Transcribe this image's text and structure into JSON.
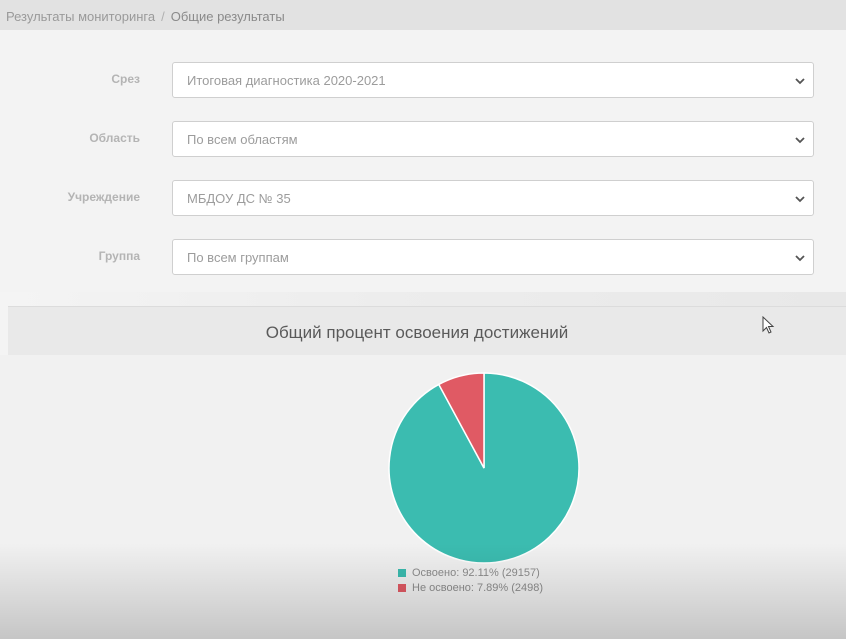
{
  "breadcrumb": {
    "parent": "Результаты мониторинга",
    "separator": "/",
    "current": "Общие результаты"
  },
  "filters": [
    {
      "label": "Срез",
      "value": "Итоговая диагностика 2020-2021"
    },
    {
      "label": "Область",
      "value": "По всем областям"
    },
    {
      "label": "Учреждение",
      "value": "МБДОУ ДС № 35"
    },
    {
      "label": "Группа",
      "value": "По всем группам"
    }
  ],
  "icons": {
    "dropdown": "chevron-down-icon",
    "cursor": "mouse-pointer-icon"
  },
  "chart_data": {
    "type": "pie",
    "title": "Общий процент освоения достижений",
    "slices": [
      {
        "name": "Освоено",
        "percent": 92.11,
        "count": 29157,
        "color": "#3bbcb0"
      },
      {
        "name": "Не освоено",
        "percent": 7.89,
        "count": 2498,
        "color": "#e05a64"
      }
    ],
    "legend": [
      "Освоено: 92.11% (29157)",
      "Не освоено: 7.89% (2498)"
    ],
    "legend_position": "bottom"
  }
}
